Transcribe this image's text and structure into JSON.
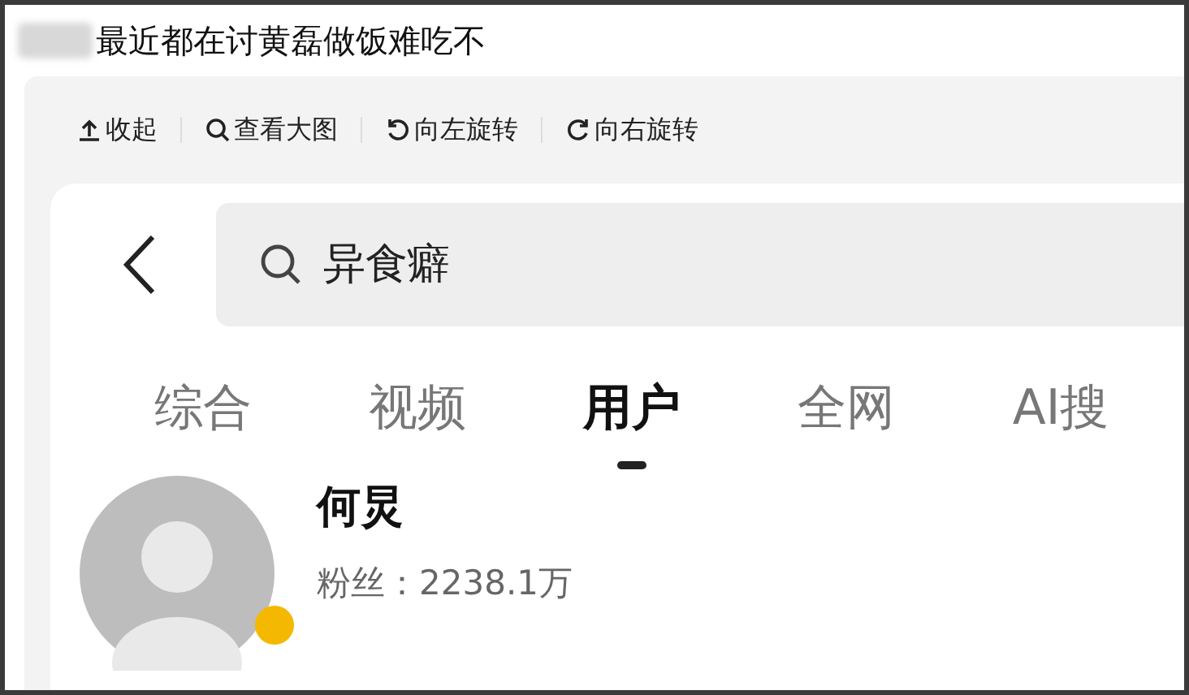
{
  "post": {
    "text": "最近都在讨黄磊做饭难吃不"
  },
  "toolbar": [
    {
      "kind": "collapse",
      "label": "收起"
    },
    {
      "kind": "zoom",
      "label": "查看大图"
    },
    {
      "kind": "rotate_left",
      "label": "向左旋转"
    },
    {
      "kind": "rotate_right",
      "label": "向右旋转"
    }
  ],
  "search": {
    "value": "异食癖"
  },
  "tabs": [
    {
      "label": "综合",
      "selected": false
    },
    {
      "label": "视频",
      "selected": false
    },
    {
      "label": "用户",
      "selected": true
    },
    {
      "label": "全网",
      "selected": false
    },
    {
      "label": "AI搜",
      "selected": false
    }
  ],
  "user": {
    "name": "何炅",
    "followers": "粉丝：2238.1万"
  }
}
